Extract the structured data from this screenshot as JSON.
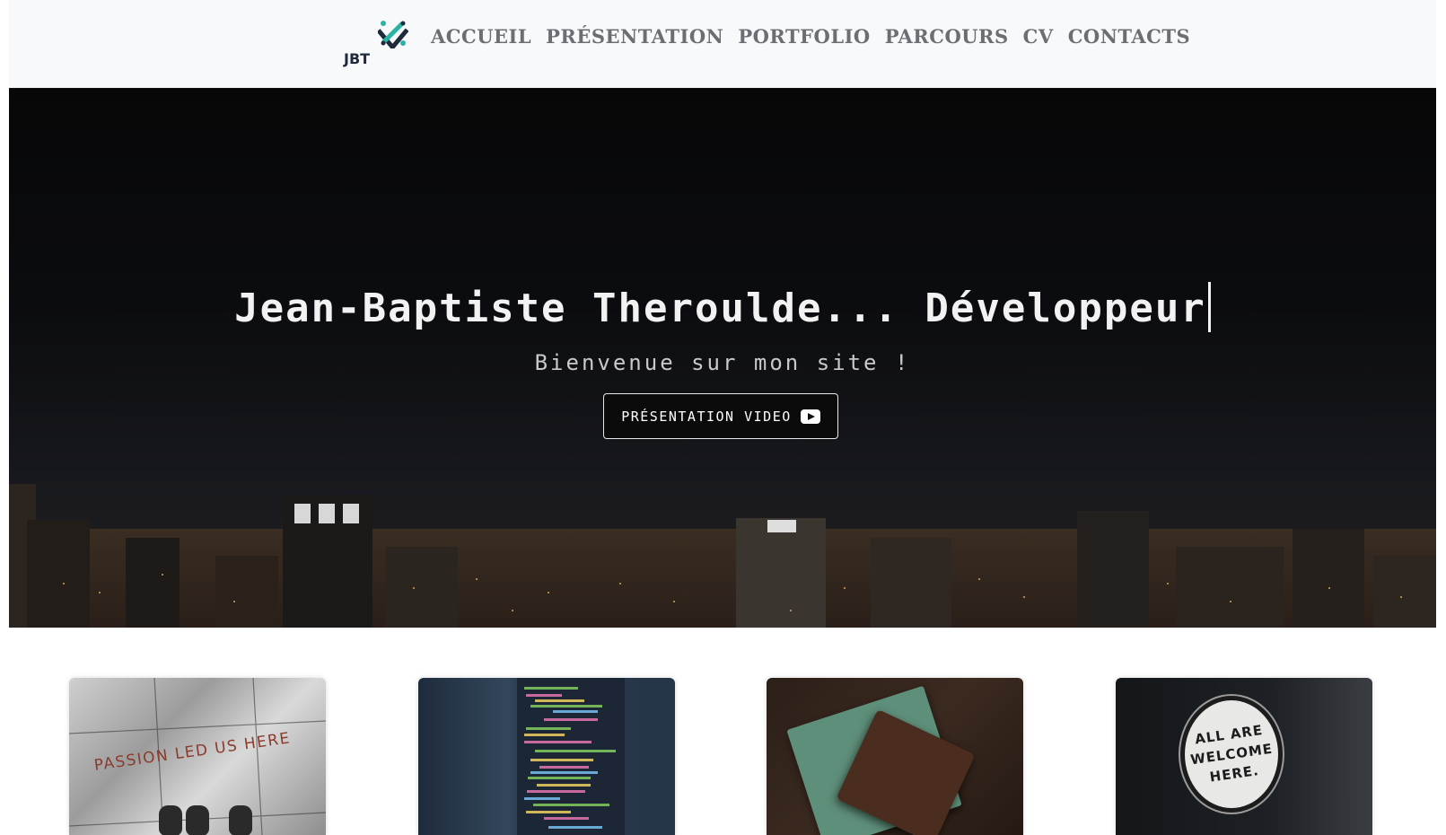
{
  "header": {
    "logo_text": "JBT",
    "nav": [
      {
        "label": "ACCUEIL"
      },
      {
        "label": "PRÉSENTATION"
      },
      {
        "label": "PORTFOLIO"
      },
      {
        "label": "PARCOURS"
      },
      {
        "label": "CV"
      },
      {
        "label": "CONTACTS"
      }
    ]
  },
  "hero": {
    "title": "Jean-Baptiste Theroulde... Développeur",
    "subtitle": "Bienvenue sur mon site !",
    "button_label": "PRÉSENTATION VIDEO"
  },
  "cards": [
    {
      "image_text": "PASSION LED US HERE"
    },
    {
      "image_text": ""
    },
    {
      "image_text": ""
    },
    {
      "image_text": "ALL ARE\nWELCOME\nHERE."
    }
  ],
  "colors": {
    "nav_background": "#f8f9fa",
    "nav_text": "#6b6e73",
    "hero_background": "#0b0c0f",
    "hero_text": "#f2f2f2",
    "logo_accent": "#2bb3a3"
  }
}
